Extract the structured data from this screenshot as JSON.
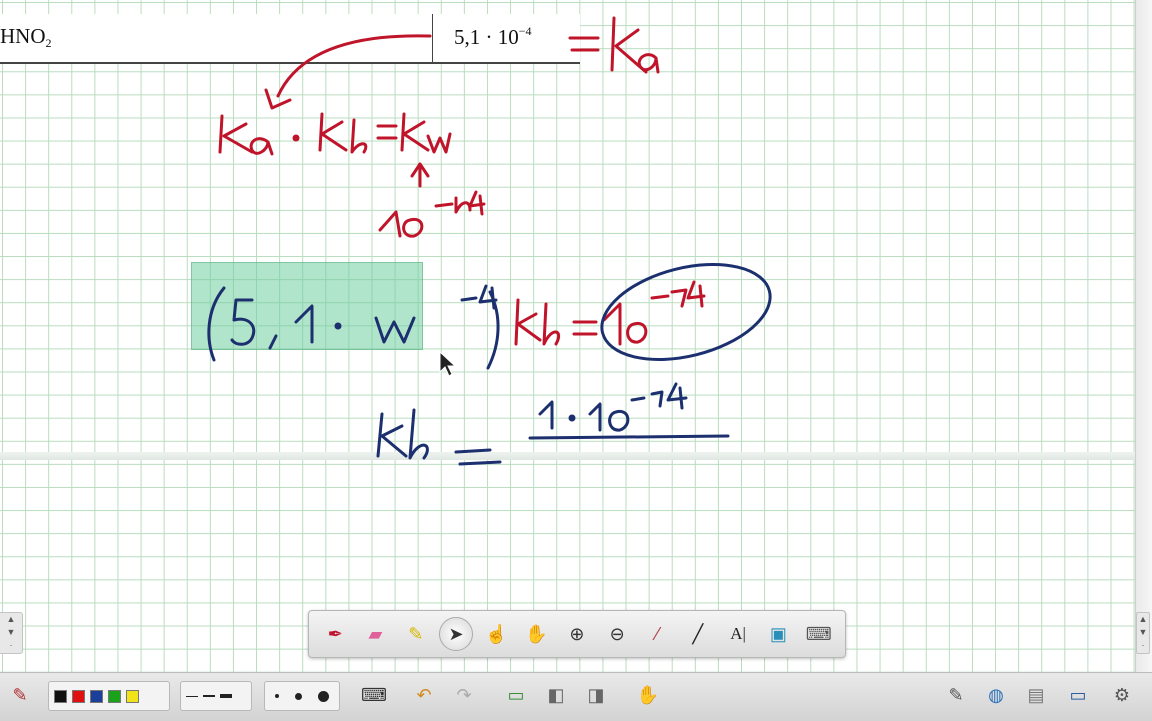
{
  "table": {
    "compound_base": "HNO",
    "compound_sub": "2",
    "value_base": "5,1 · 10",
    "value_exp": "−4"
  },
  "ink_colors": {
    "red": "#c0142a",
    "blue": "#1c2f6e",
    "highlight": "#6fcda0"
  },
  "pen_toolbar": {
    "tools": [
      {
        "name": "pen-tool-icon",
        "glyph": "✒"
      },
      {
        "name": "eraser-tool-icon",
        "glyph": "▭"
      },
      {
        "name": "highlighter-tool-icon",
        "glyph": "✎"
      },
      {
        "name": "select-pointer-icon",
        "glyph": "➤"
      },
      {
        "name": "hand-pointer-icon",
        "glyph": "☝"
      },
      {
        "name": "pan-hand-icon",
        "glyph": "✋"
      },
      {
        "name": "zoom-in-icon",
        "glyph": "⊕"
      },
      {
        "name": "zoom-out-icon",
        "glyph": "⊖"
      },
      {
        "name": "pipette-icon",
        "glyph": "⁄"
      },
      {
        "name": "line-tool-icon",
        "glyph": "╱"
      },
      {
        "name": "text-tool-icon",
        "glyph": "AI"
      },
      {
        "name": "screen-capture-icon",
        "glyph": "▣"
      },
      {
        "name": "keyboard-icon",
        "glyph": "⌨"
      }
    ]
  },
  "taskbar": {
    "colors": [
      "#111111",
      "#e01010",
      "#1c3f9a",
      "#1aa31a",
      "#f2e21a"
    ]
  }
}
